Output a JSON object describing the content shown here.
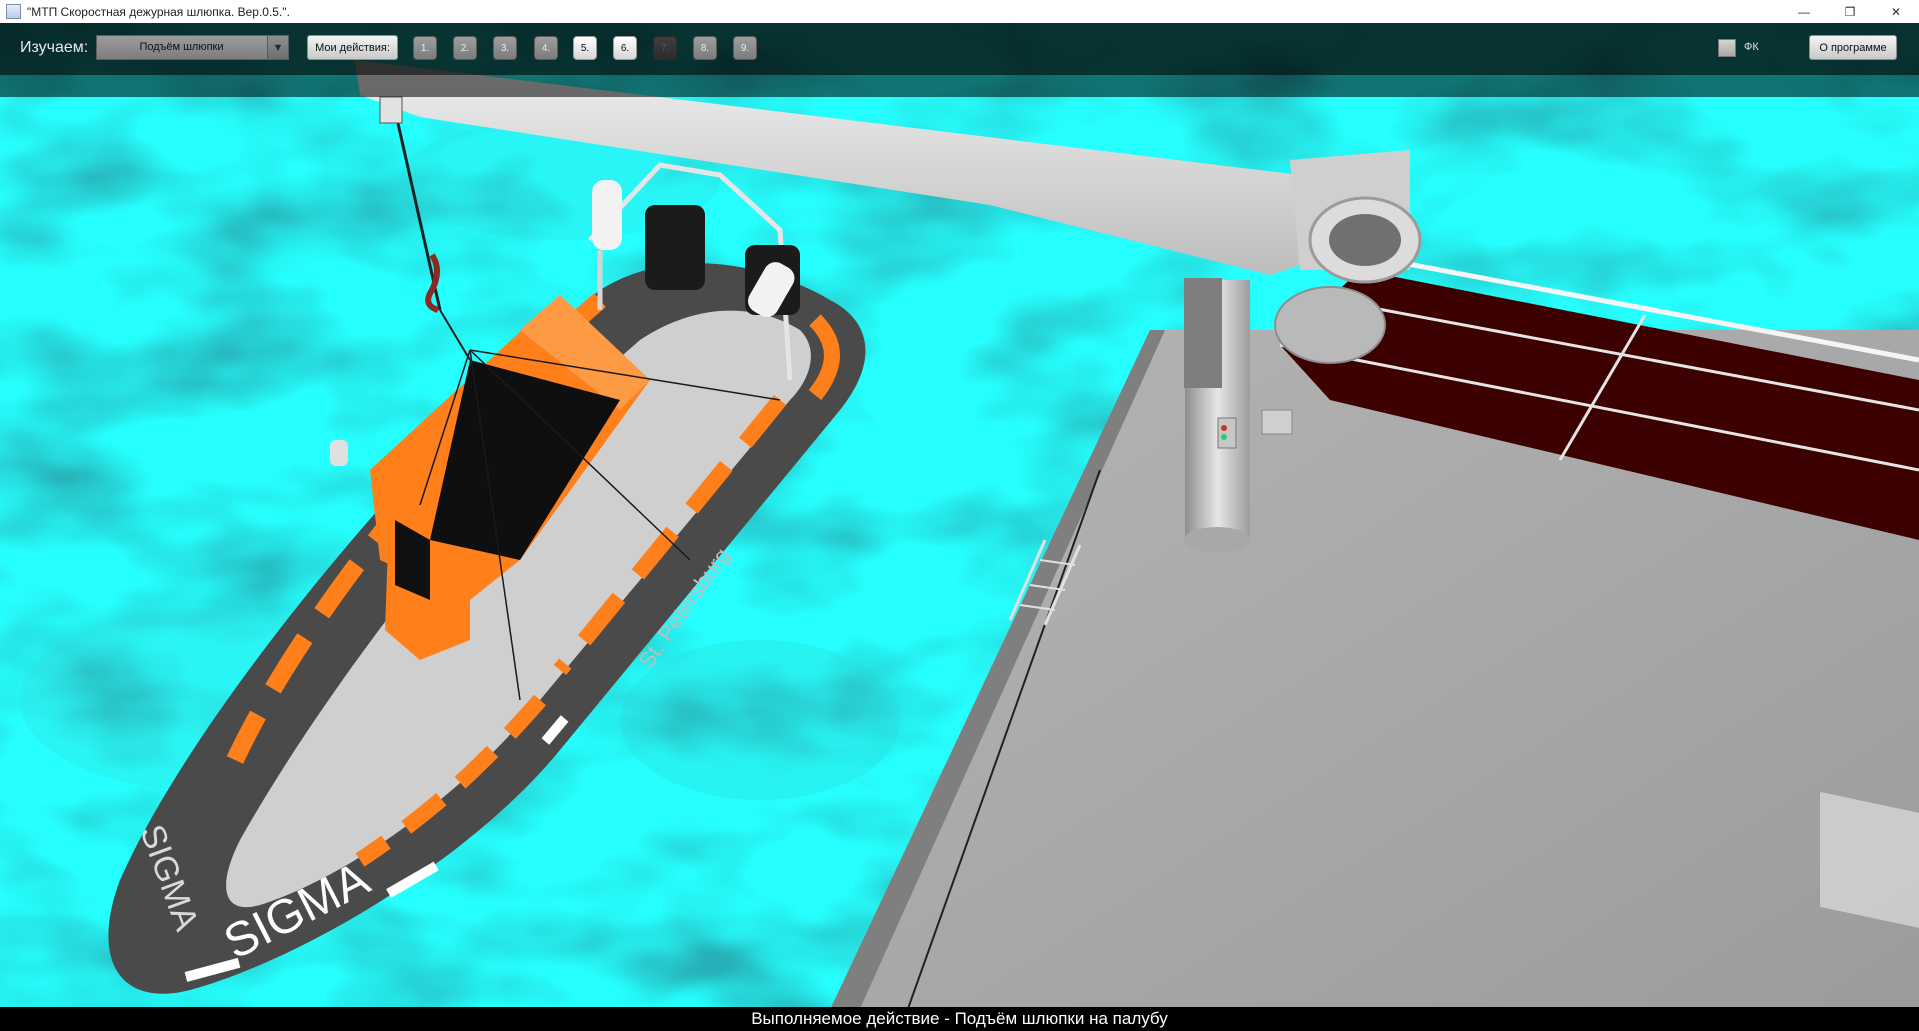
{
  "window": {
    "title": "\"МТП Скоростная дежурная шлюпка. Вер.0.5.\".",
    "minimize_glyph": "—",
    "restore_glyph": "❐",
    "close_glyph": "✕"
  },
  "toolbar": {
    "study_label": "Изучаем:",
    "study_select_value": "Подъём шлюпки",
    "my_actions_label": "Мои действия:",
    "steps": [
      {
        "label": "1.",
        "state": "normal"
      },
      {
        "label": "2.",
        "state": "normal"
      },
      {
        "label": "3.",
        "state": "normal"
      },
      {
        "label": "4.",
        "state": "normal"
      },
      {
        "label": "5.",
        "state": "active"
      },
      {
        "label": "6.",
        "state": "active"
      },
      {
        "label": "7.",
        "state": "disabled"
      },
      {
        "label": "8.",
        "state": "normal"
      },
      {
        "label": "9.",
        "state": "normal"
      }
    ],
    "fk_label": "ФК",
    "about_label": "О программе"
  },
  "scene": {
    "boat_brand": "SIGMA",
    "boat_side_text": "St. Petersburg",
    "colors": {
      "water": "#19b3b7",
      "boat_orange": "#ff7f1a",
      "tube_gray": "#4a4a4a",
      "deck": "#a9a9a9",
      "crane": "#d9d9d9",
      "railing_dark": "#3d0000"
    }
  },
  "status": {
    "text": "Выполняемое действие - Подъём шлюпки на палубу"
  }
}
